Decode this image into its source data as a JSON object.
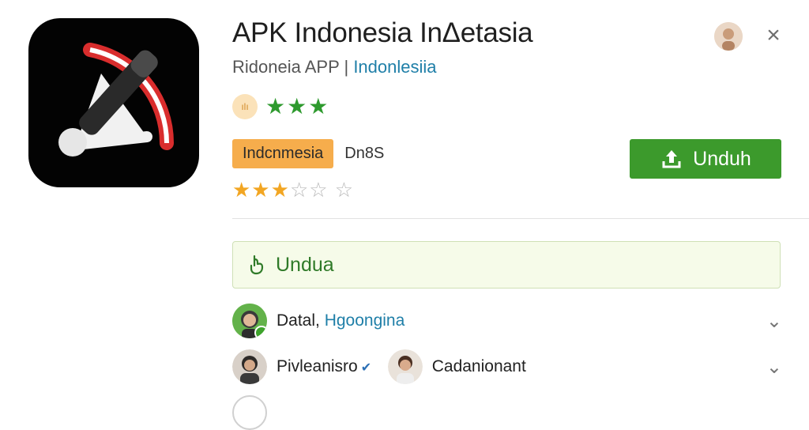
{
  "header": {
    "title": "APK Indonesia InΔetasia",
    "subtitle_plain": "Ridoneia  APP | ",
    "subtitle_link": "Indonlesiia",
    "close_icon": "×"
  },
  "rating": {
    "badge_text": "ılı",
    "stars_green": "★★★",
    "tag": "Indcnmesia",
    "tag_text": "Dn8S",
    "stars": {
      "on": "★★★",
      "off": "☆☆ ☆"
    }
  },
  "actions": {
    "download_label": "Unduh",
    "download_box_label": "Undua"
  },
  "rows": [
    {
      "label": "Datal, ",
      "label_blue": "Hgoongina"
    },
    {
      "label": "Pivleanisro",
      "label2": "Cadanionant"
    }
  ],
  "colors": {
    "green": "#3c9a2c",
    "orange": "#f6ad4c",
    "blue_link": "#1f7fa8"
  }
}
